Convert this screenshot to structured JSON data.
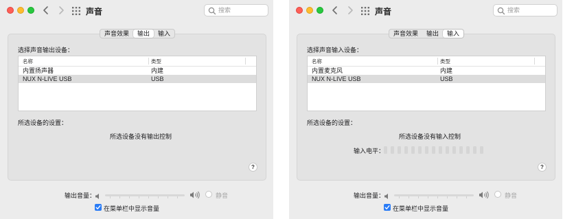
{
  "left_window": {
    "title": "声音",
    "search_placeholder": "搜索",
    "tabs": [
      {
        "label": "声音效果",
        "selected": false
      },
      {
        "label": "输出",
        "selected": true
      },
      {
        "label": "输入",
        "selected": false
      }
    ],
    "device_section_label": "选择声音输出设备：",
    "table": {
      "headers": [
        "名称",
        "类型"
      ],
      "rows": [
        {
          "name": "内置扬声器",
          "type": "内建",
          "selected": false
        },
        {
          "name": "NUX N-LIVE USB",
          "type": "USB",
          "selected": true
        }
      ]
    },
    "settings_label": "所选设备的设置：",
    "no_controls_text": "所选设备没有输出控制",
    "help_label": "?",
    "volume_label": "输出音量：",
    "mute_label": "静音",
    "show_in_menubar_label": "在菜单栏中显示音量",
    "show_in_menubar_checked": true
  },
  "right_window": {
    "title": "声音",
    "search_placeholder": "搜索",
    "tabs": [
      {
        "label": "声音效果",
        "selected": false
      },
      {
        "label": "输出",
        "selected": false
      },
      {
        "label": "输入",
        "selected": true
      }
    ],
    "device_section_label": "选择声音输入设备：",
    "table": {
      "headers": [
        "名称",
        "类型"
      ],
      "rows": [
        {
          "name": "内置麦克风",
          "type": "内建",
          "selected": false
        },
        {
          "name": "NUX N-LIVE USB",
          "type": "USB",
          "selected": true
        }
      ]
    },
    "settings_label": "所选设备的设置：",
    "no_controls_text": "所选设备没有输入控制",
    "input_level_label": "输入电平：",
    "input_level_bars_lit": 0,
    "input_level_bars_total": 15,
    "help_label": "?",
    "volume_label": "输出音量：",
    "mute_label": "静音",
    "show_in_menubar_label": "在菜单栏中显示音量",
    "show_in_menubar_checked": true
  },
  "colors": {
    "window_bg": "#ececec",
    "panel_bg": "#e3e3e3",
    "selected_row": "#dcdcdc",
    "accent": "#2a7cf6",
    "close": "#fe5f57",
    "minimize": "#febc2e",
    "zoom": "#28c840"
  },
  "icons": [
    "back-chevron-icon",
    "forward-chevron-icon",
    "grid-icon",
    "search-icon",
    "speaker-low-icon",
    "speaker-high-icon",
    "checkmark-icon"
  ]
}
